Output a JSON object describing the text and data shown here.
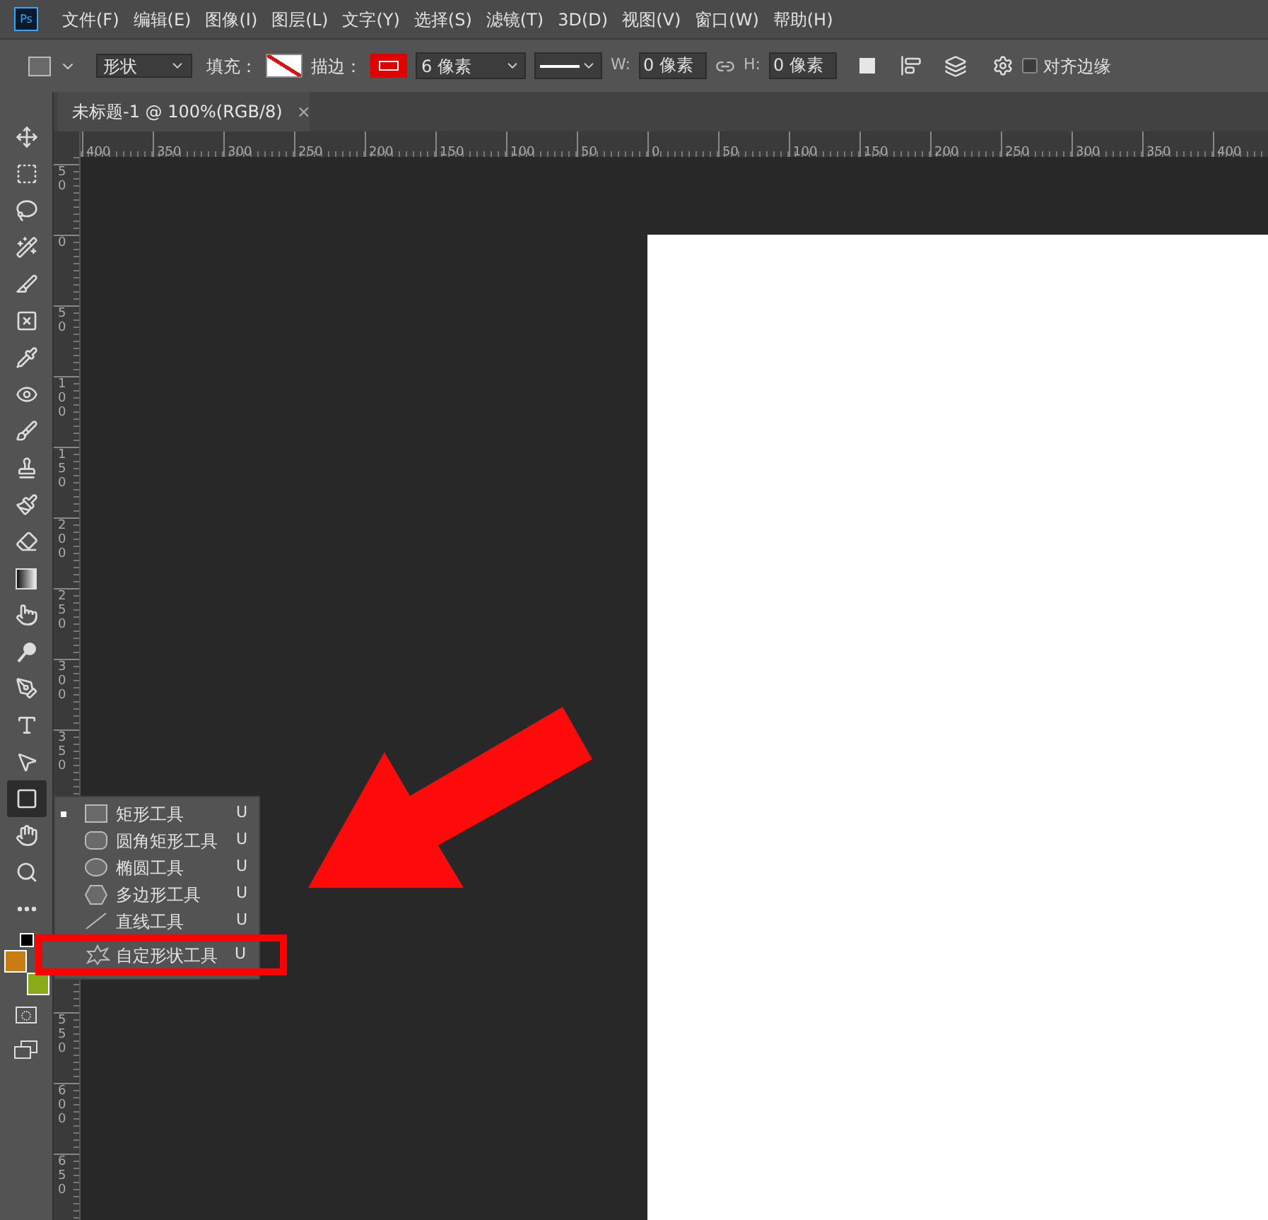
{
  "app_logo": "Ps",
  "menu": [
    "文件(F)",
    "编辑(E)",
    "图像(I)",
    "图层(L)",
    "文字(Y)",
    "选择(S)",
    "滤镜(T)",
    "3D(D)",
    "视图(V)",
    "窗口(W)",
    "帮助(H)"
  ],
  "options_bar": {
    "mode": "形状",
    "fill_label": "填充：",
    "stroke_label": "描边：",
    "stroke_width": "6 像素",
    "w_label": "W:",
    "w_value": "0 像素",
    "h_label": "H:",
    "h_value": "0 像素",
    "align_edges": {
      "label": "对齐边缘",
      "checked": false
    }
  },
  "document_tab": {
    "title": "未标题-1 @ 100%(RGB/8)",
    "close": "×",
    "selected": true
  },
  "horizontal_ruler": [
    "400",
    "350",
    "300",
    "250",
    "200",
    "150",
    "100",
    "50",
    "0",
    "50",
    "100",
    "150",
    "200",
    "250",
    "300",
    "350",
    "400"
  ],
  "vertical_ruler_upper": [
    "50",
    "0",
    "50",
    "100",
    "150",
    "200",
    "250",
    "300",
    "350"
  ],
  "vertical_ruler_lower": [
    "550",
    "600",
    "650"
  ],
  "tools": [
    {
      "kind": "move",
      "selected": false
    },
    {
      "kind": "marquee",
      "selected": false
    },
    {
      "kind": "lasso",
      "selected": false
    },
    {
      "kind": "wand",
      "selected": false
    },
    {
      "kind": "slice",
      "selected": false
    },
    {
      "kind": "frame",
      "selected": false
    },
    {
      "kind": "eyedropper",
      "selected": false
    },
    {
      "kind": "healing",
      "selected": false
    },
    {
      "kind": "brush",
      "selected": false
    },
    {
      "kind": "stamp",
      "selected": false
    },
    {
      "kind": "history",
      "selected": false
    },
    {
      "kind": "eraser",
      "selected": false
    },
    {
      "kind": "gradient",
      "selected": false
    },
    {
      "kind": "smudge",
      "selected": false
    },
    {
      "kind": "dodge",
      "selected": false
    },
    {
      "kind": "pen",
      "selected": false
    },
    {
      "kind": "type",
      "selected": false
    },
    {
      "kind": "select",
      "selected": false
    },
    {
      "kind": "rectangle",
      "selected": true
    },
    {
      "kind": "hand",
      "selected": false
    },
    {
      "kind": "zoom",
      "selected": false
    },
    {
      "kind": "more",
      "selected": false
    }
  ],
  "color_swatches": [
    {
      "kind": "foreground",
      "color": "#c87d12"
    },
    {
      "kind": "background",
      "color": "#8aaa1a"
    }
  ],
  "shape_flyout": [
    {
      "kind": "rect",
      "label": "矩形工具",
      "shortcut": "U",
      "selected": true,
      "highlighted": false
    },
    {
      "kind": "rounded",
      "label": "圆角矩形工具",
      "shortcut": "U",
      "selected": false,
      "highlighted": false
    },
    {
      "kind": "ellipse",
      "label": "椭圆工具",
      "shortcut": "U",
      "selected": false,
      "highlighted": false
    },
    {
      "kind": "polygon",
      "label": "多边形工具",
      "shortcut": "U",
      "selected": false,
      "highlighted": false
    },
    {
      "kind": "line",
      "label": "直线工具",
      "shortcut": "U",
      "selected": false,
      "highlighted": false
    },
    {
      "kind": "custom",
      "label": "自定形状工具",
      "shortcut": "U",
      "selected": false,
      "highlighted": true
    }
  ]
}
